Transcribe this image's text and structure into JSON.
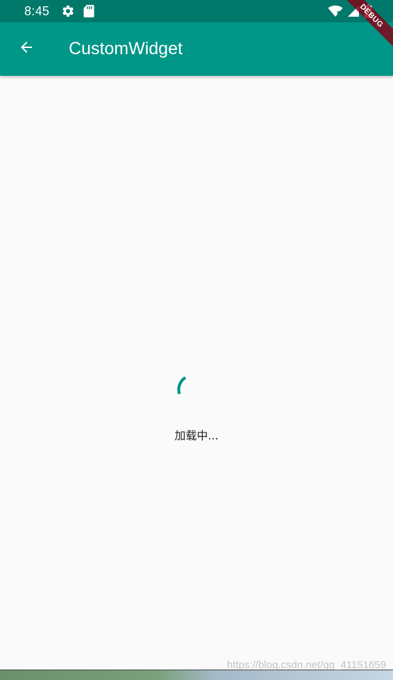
{
  "status_bar": {
    "time": "8:45",
    "left_icons": [
      "settings-icon",
      "sd-card-icon"
    ],
    "right_icons": [
      "wifi-icon",
      "signal-icon",
      "battery-charging-icon"
    ],
    "background": "#00796b"
  },
  "debug_banner": {
    "label": "DEBUG",
    "color": "#880015"
  },
  "app_bar": {
    "title": "CustomWidget",
    "back_icon": "arrow-back-icon",
    "background": "#009688"
  },
  "loading": {
    "text": "加载中...",
    "spinner_color": "#009688"
  },
  "watermark": {
    "text": "https://blog.csdn.net/qq_41151659"
  }
}
